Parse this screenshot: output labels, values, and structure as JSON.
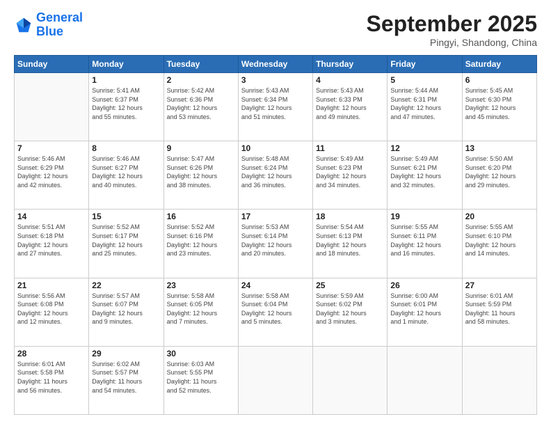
{
  "logo": {
    "line1": "General",
    "line2": "Blue"
  },
  "header": {
    "title": "September 2025",
    "subtitle": "Pingyi, Shandong, China"
  },
  "days_of_week": [
    "Sunday",
    "Monday",
    "Tuesday",
    "Wednesday",
    "Thursday",
    "Friday",
    "Saturday"
  ],
  "weeks": [
    [
      {
        "day": "",
        "info": ""
      },
      {
        "day": "1",
        "info": "Sunrise: 5:41 AM\nSunset: 6:37 PM\nDaylight: 12 hours\nand 55 minutes."
      },
      {
        "day": "2",
        "info": "Sunrise: 5:42 AM\nSunset: 6:36 PM\nDaylight: 12 hours\nand 53 minutes."
      },
      {
        "day": "3",
        "info": "Sunrise: 5:43 AM\nSunset: 6:34 PM\nDaylight: 12 hours\nand 51 minutes."
      },
      {
        "day": "4",
        "info": "Sunrise: 5:43 AM\nSunset: 6:33 PM\nDaylight: 12 hours\nand 49 minutes."
      },
      {
        "day": "5",
        "info": "Sunrise: 5:44 AM\nSunset: 6:31 PM\nDaylight: 12 hours\nand 47 minutes."
      },
      {
        "day": "6",
        "info": "Sunrise: 5:45 AM\nSunset: 6:30 PM\nDaylight: 12 hours\nand 45 minutes."
      }
    ],
    [
      {
        "day": "7",
        "info": "Sunrise: 5:46 AM\nSunset: 6:29 PM\nDaylight: 12 hours\nand 42 minutes."
      },
      {
        "day": "8",
        "info": "Sunrise: 5:46 AM\nSunset: 6:27 PM\nDaylight: 12 hours\nand 40 minutes."
      },
      {
        "day": "9",
        "info": "Sunrise: 5:47 AM\nSunset: 6:26 PM\nDaylight: 12 hours\nand 38 minutes."
      },
      {
        "day": "10",
        "info": "Sunrise: 5:48 AM\nSunset: 6:24 PM\nDaylight: 12 hours\nand 36 minutes."
      },
      {
        "day": "11",
        "info": "Sunrise: 5:49 AM\nSunset: 6:23 PM\nDaylight: 12 hours\nand 34 minutes."
      },
      {
        "day": "12",
        "info": "Sunrise: 5:49 AM\nSunset: 6:21 PM\nDaylight: 12 hours\nand 32 minutes."
      },
      {
        "day": "13",
        "info": "Sunrise: 5:50 AM\nSunset: 6:20 PM\nDaylight: 12 hours\nand 29 minutes."
      }
    ],
    [
      {
        "day": "14",
        "info": "Sunrise: 5:51 AM\nSunset: 6:18 PM\nDaylight: 12 hours\nand 27 minutes."
      },
      {
        "day": "15",
        "info": "Sunrise: 5:52 AM\nSunset: 6:17 PM\nDaylight: 12 hours\nand 25 minutes."
      },
      {
        "day": "16",
        "info": "Sunrise: 5:52 AM\nSunset: 6:16 PM\nDaylight: 12 hours\nand 23 minutes."
      },
      {
        "day": "17",
        "info": "Sunrise: 5:53 AM\nSunset: 6:14 PM\nDaylight: 12 hours\nand 20 minutes."
      },
      {
        "day": "18",
        "info": "Sunrise: 5:54 AM\nSunset: 6:13 PM\nDaylight: 12 hours\nand 18 minutes."
      },
      {
        "day": "19",
        "info": "Sunrise: 5:55 AM\nSunset: 6:11 PM\nDaylight: 12 hours\nand 16 minutes."
      },
      {
        "day": "20",
        "info": "Sunrise: 5:55 AM\nSunset: 6:10 PM\nDaylight: 12 hours\nand 14 minutes."
      }
    ],
    [
      {
        "day": "21",
        "info": "Sunrise: 5:56 AM\nSunset: 6:08 PM\nDaylight: 12 hours\nand 12 minutes."
      },
      {
        "day": "22",
        "info": "Sunrise: 5:57 AM\nSunset: 6:07 PM\nDaylight: 12 hours\nand 9 minutes."
      },
      {
        "day": "23",
        "info": "Sunrise: 5:58 AM\nSunset: 6:05 PM\nDaylight: 12 hours\nand 7 minutes."
      },
      {
        "day": "24",
        "info": "Sunrise: 5:58 AM\nSunset: 6:04 PM\nDaylight: 12 hours\nand 5 minutes."
      },
      {
        "day": "25",
        "info": "Sunrise: 5:59 AM\nSunset: 6:02 PM\nDaylight: 12 hours\nand 3 minutes."
      },
      {
        "day": "26",
        "info": "Sunrise: 6:00 AM\nSunset: 6:01 PM\nDaylight: 12 hours\nand 1 minute."
      },
      {
        "day": "27",
        "info": "Sunrise: 6:01 AM\nSunset: 5:59 PM\nDaylight: 11 hours\nand 58 minutes."
      }
    ],
    [
      {
        "day": "28",
        "info": "Sunrise: 6:01 AM\nSunset: 5:58 PM\nDaylight: 11 hours\nand 56 minutes."
      },
      {
        "day": "29",
        "info": "Sunrise: 6:02 AM\nSunset: 5:57 PM\nDaylight: 11 hours\nand 54 minutes."
      },
      {
        "day": "30",
        "info": "Sunrise: 6:03 AM\nSunset: 5:55 PM\nDaylight: 11 hours\nand 52 minutes."
      },
      {
        "day": "",
        "info": ""
      },
      {
        "day": "",
        "info": ""
      },
      {
        "day": "",
        "info": ""
      },
      {
        "day": "",
        "info": ""
      }
    ]
  ]
}
